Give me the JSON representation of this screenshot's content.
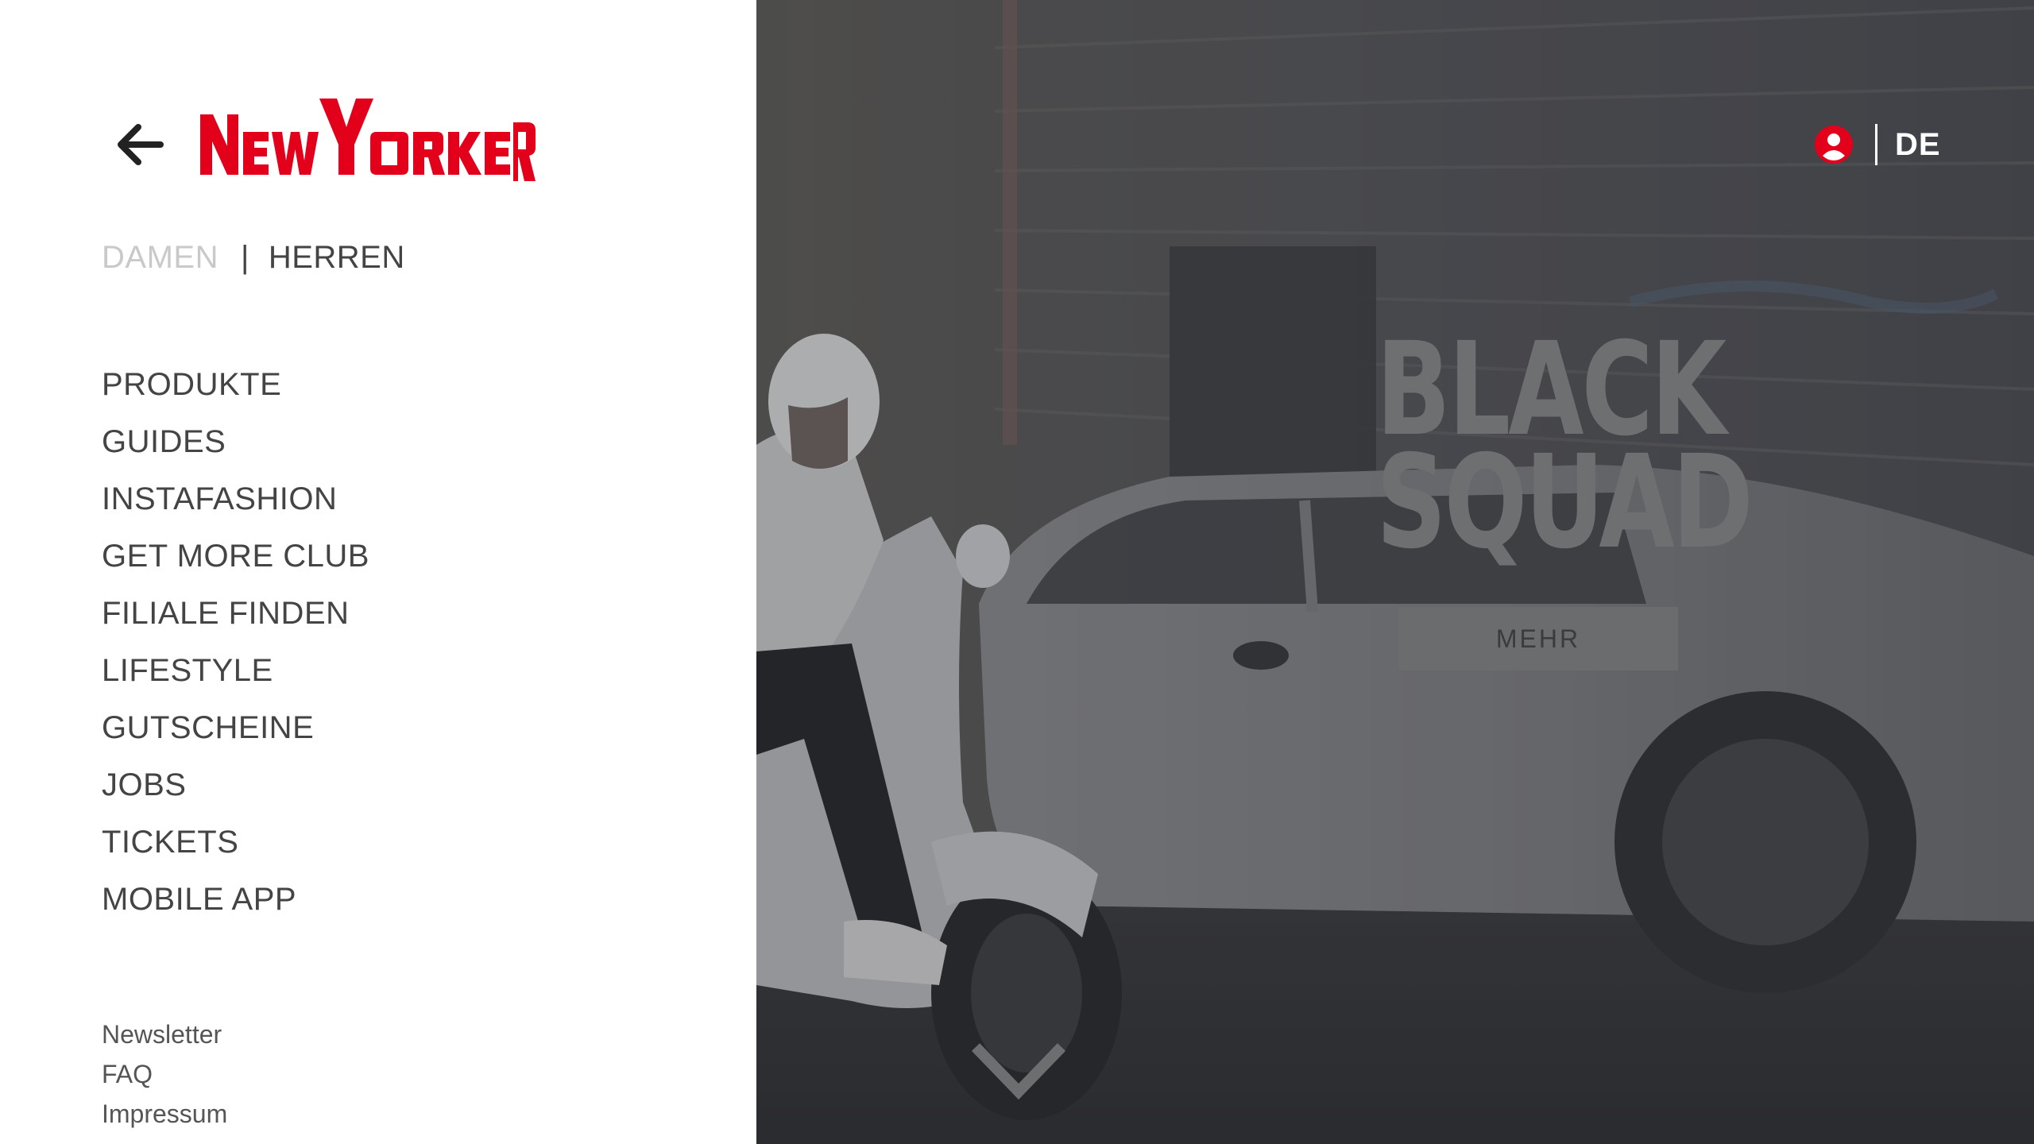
{
  "brand": {
    "name": "NEWYORKER",
    "color": "#e2001a"
  },
  "header": {
    "language": "DE"
  },
  "gender_switch": {
    "damen": "DAMEN",
    "separator": "|",
    "herren": "HERREN",
    "active": "herren"
  },
  "main_nav": [
    {
      "label": "PRODUKTE"
    },
    {
      "label": "GUIDES"
    },
    {
      "label": "INSTAFASHION"
    },
    {
      "label": "GET MORE CLUB"
    },
    {
      "label": "FILIALE FINDEN"
    },
    {
      "label": "LIFESTYLE"
    },
    {
      "label": "GUTSCHEINE"
    },
    {
      "label": "JOBS"
    },
    {
      "label": "TICKETS"
    },
    {
      "label": "MOBILE APP"
    }
  ],
  "footer_nav": [
    {
      "label": "Newsletter"
    },
    {
      "label": "FAQ"
    },
    {
      "label": "Impressum"
    }
  ],
  "hero": {
    "campaign_line1": "BLACK",
    "campaign_line2": "SQUAD",
    "cta_label": "MEHR",
    "icons": {
      "account": "account-icon",
      "scroll": "chevron-down-icon",
      "back": "arrow-left-icon"
    }
  }
}
